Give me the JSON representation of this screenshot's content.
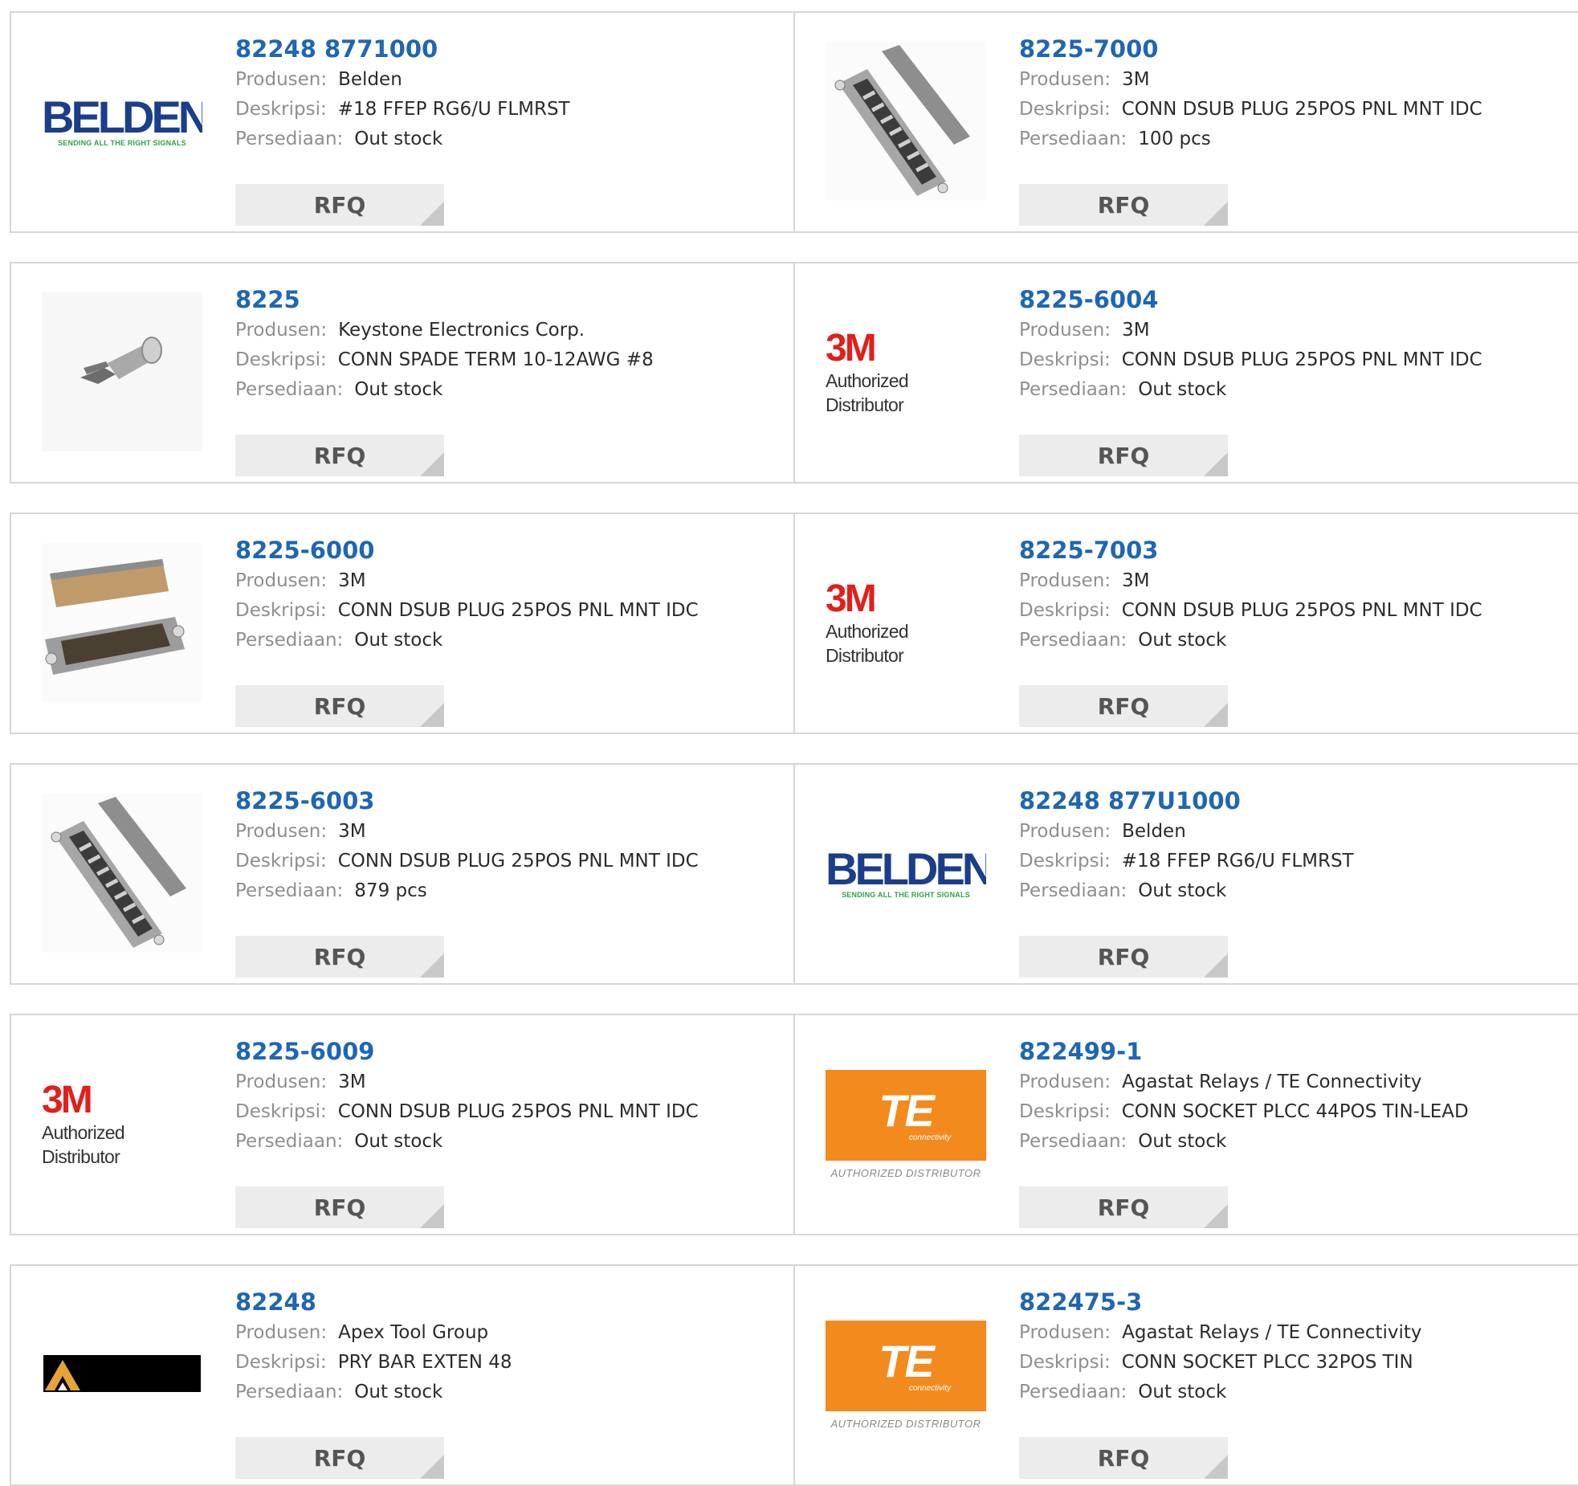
{
  "labels": {
    "manufacturer": "Produsen:",
    "description": "Deskripsi:",
    "stock": "Persediaan:",
    "rfq": "RFQ"
  },
  "products": [
    {
      "part": "82248 8771000",
      "manufacturer": "Belden",
      "description": "#18 FFEP RG6/U FLMRST",
      "stock": "Out stock",
      "image": "belden-logo"
    },
    {
      "part": "8225-7000",
      "manufacturer": "3M",
      "description": "CONN DSUB PLUG 25POS PNL MNT IDC",
      "stock": "100 pcs",
      "image": "dsub-connector-photo"
    },
    {
      "part": "8225",
      "manufacturer": "Keystone Electronics Corp.",
      "description": "CONN SPADE TERM 10-12AWG #8",
      "stock": "Out stock",
      "image": "spade-terminal-photo"
    },
    {
      "part": "8225-6004",
      "manufacturer": "3M",
      "description": "CONN DSUB PLUG 25POS PNL MNT IDC",
      "stock": "Out stock",
      "image": "3m-logo"
    },
    {
      "part": "8225-6000",
      "manufacturer": "3M",
      "description": "CONN DSUB PLUG 25POS PNL MNT IDC",
      "stock": "Out stock",
      "image": "dsub-plug-photo"
    },
    {
      "part": "8225-7003",
      "manufacturer": "3M",
      "description": "CONN DSUB PLUG 25POS PNL MNT IDC",
      "stock": "Out stock",
      "image": "3m-logo"
    },
    {
      "part": "8225-6003",
      "manufacturer": "3M",
      "description": "CONN DSUB PLUG 25POS PNL MNT IDC",
      "stock": "879 pcs",
      "image": "dsub-connector-photo"
    },
    {
      "part": "82248 877U1000",
      "manufacturer": "Belden",
      "description": "#18 FFEP RG6/U FLMRST",
      "stock": "Out stock",
      "image": "belden-logo"
    },
    {
      "part": "8225-6009",
      "manufacturer": "3M",
      "description": "CONN DSUB PLUG 25POS PNL MNT IDC",
      "stock": "Out stock",
      "image": "3m-logo"
    },
    {
      "part": "822499-1",
      "manufacturer": "Agastat Relays / TE Connectivity",
      "description": "CONN SOCKET PLCC 44POS TIN-LEAD",
      "stock": "Out stock",
      "image": "te-logo"
    },
    {
      "part": "82248",
      "manufacturer": "Apex Tool Group",
      "description": "PRY BAR EXTEN 48",
      "stock": "Out stock",
      "image": "apex-logo"
    },
    {
      "part": "822475-3",
      "manufacturer": "Agastat Relays / TE Connectivity",
      "description": "CONN SOCKET PLCC 32POS TIN",
      "stock": "Out stock",
      "image": "te-logo"
    }
  ],
  "logos": {
    "belden": {
      "word": "BELDEN",
      "tagline": "SENDING ALL THE RIGHT SIGNALS",
      "color": "#1a3e8c",
      "tag_color": "#2fa24a"
    },
    "3m": {
      "mark": "3M",
      "sub": "Authorized Distributor",
      "color": "#e0201b"
    },
    "te": {
      "mark": "TE",
      "small": "connectivity",
      "auth": "AUTHORIZED DISTRIBUTOR",
      "color": "#f28a1e"
    }
  },
  "colors": {
    "part_link": "#1f66b3",
    "border": "#d6d6d6",
    "rfq_bg": "#ececec"
  }
}
